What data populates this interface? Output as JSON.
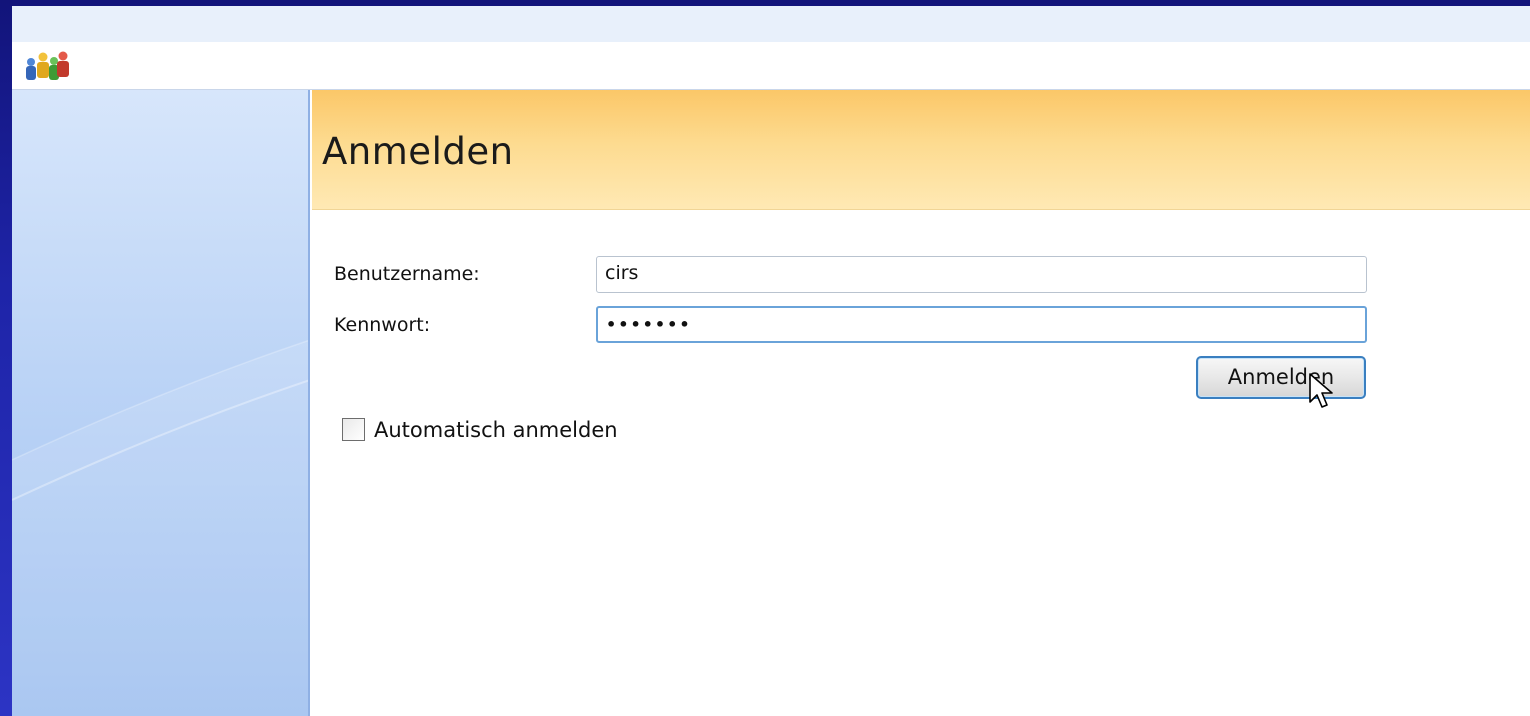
{
  "header": {
    "title": "Anmelden"
  },
  "form": {
    "username_label": "Benutzername:",
    "username_value": "cirs",
    "password_label": "Kennwort:",
    "password_value_masked": "•••••••",
    "submit_label": "Anmelden",
    "auto_login_label": "Automatisch anmelden",
    "auto_login_checked": false
  },
  "icons": {
    "app": "users-group-icon",
    "cursor": "mouse-pointer-icon"
  },
  "colors": {
    "header_gradient_top": "#fbc768",
    "header_gradient_bottom": "#ffe9b4",
    "sidebar_top": "#d7e6fb",
    "sidebar_bottom": "#9fc0f0",
    "button_border": "#3a7fc0"
  }
}
